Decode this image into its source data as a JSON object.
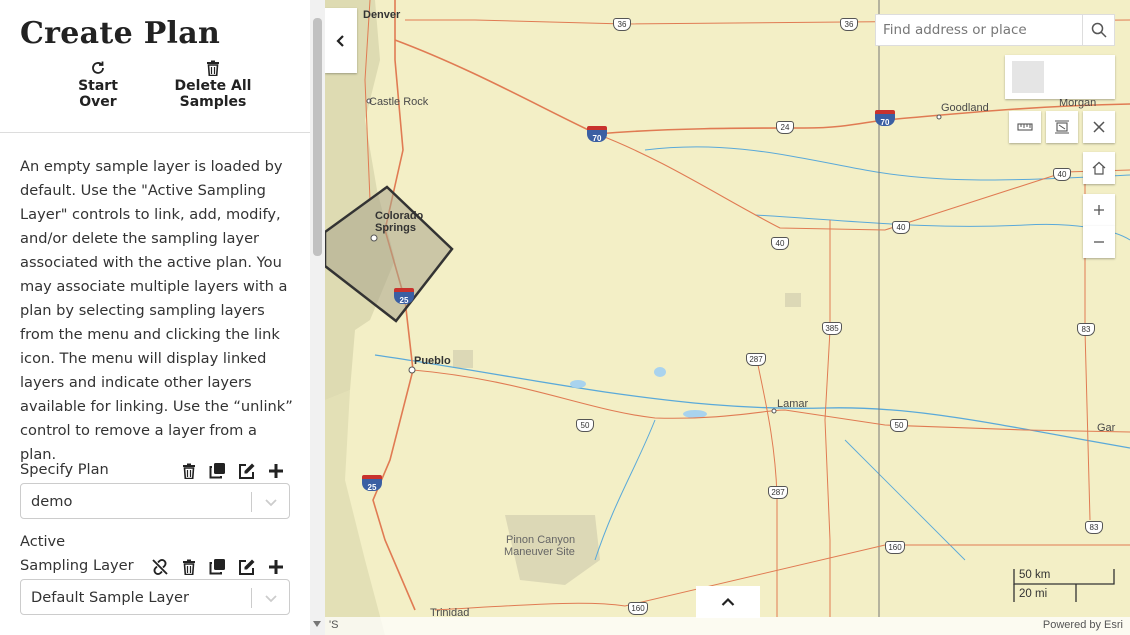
{
  "sidebar": {
    "title": "Create Plan",
    "start_over_label": "Start Over",
    "delete_all_label": "Delete All Samples",
    "description": "An empty sample layer is loaded by default. Use the \"Active Sampling Layer\" controls to link, add, modify, and/or delete the sampling layer associated with the active plan. You may associate multiple layers with a plan by selecting sampling layers from the menu and clicking the link icon. The menu will display linked layers and indicate other layers available for linking. Use the “unlink” control to remove a layer from a plan.",
    "specify_plan": {
      "label": "Specify Plan",
      "value": "demo",
      "icons": [
        "delete-icon",
        "clone-icon",
        "edit-icon",
        "add-icon"
      ]
    },
    "active_layer": {
      "label_line1": "Active",
      "label_line2": "Sampling Layer",
      "value": "Default Sample Layer",
      "icons": [
        "unlink-icon",
        "delete-icon",
        "clone-icon",
        "edit-icon",
        "add-icon"
      ]
    }
  },
  "map": {
    "search_placeholder": "Find address or place",
    "places": {
      "denver": "Denver",
      "castle_rock": "Castle Rock",
      "colorado_springs_1": "Colorado",
      "colorado_springs_2": "Springs",
      "pueblo": "Pueblo",
      "goodland": "Goodland",
      "morgan": "Morgan",
      "lamar": "Lamar",
      "garden": "Gar",
      "pinon_1": "Pinon Canyon",
      "pinon_2": "Maneuver Site",
      "trinidad": "Trinidad"
    },
    "shields": {
      "us36_a": "36",
      "us36_b": "36",
      "i70_a": "70",
      "i70_b": "70",
      "us24": "24",
      "us40_a": "40",
      "us40_b": "40",
      "us40_c": "40",
      "i25_a": "25",
      "i25_b": "25",
      "us385": "385",
      "us287_a": "287",
      "us287_b": "287",
      "us83_a": "83",
      "us83_b": "83",
      "us50_a": "50",
      "us50_b": "50",
      "us160_a": "160",
      "us160_b": "160"
    },
    "scale": {
      "km": "50 km",
      "mi": "20 mi"
    },
    "attribution_left": "'S",
    "attribution_right": "Powered by Esri"
  },
  "colors": {
    "map_bg": "#f3efc6",
    "road": "#e07b53",
    "water": "#5aa9d9",
    "polygon_fill": "#a9a48c",
    "polygon_stroke": "#333333"
  }
}
